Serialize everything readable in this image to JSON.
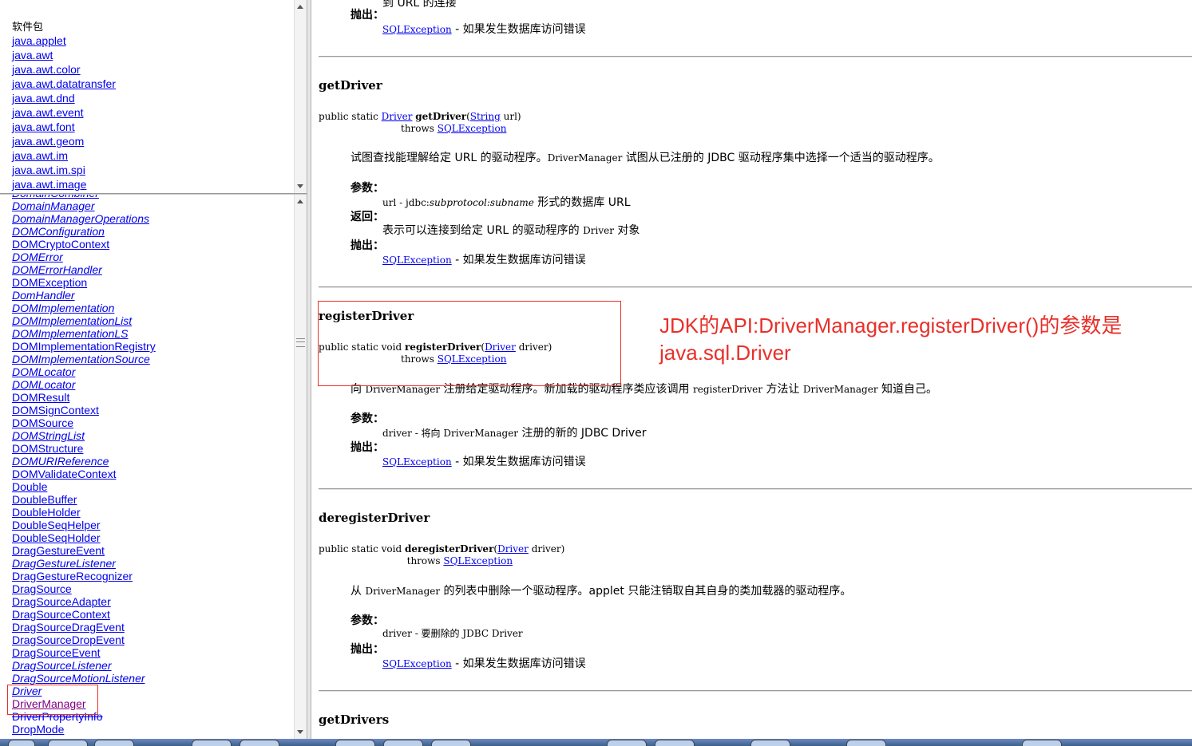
{
  "package_frame": {
    "heading": "软件包",
    "items": [
      "java.applet",
      "java.awt",
      "java.awt.color",
      "java.awt.datatransfer",
      "java.awt.dnd",
      "java.awt.event",
      "java.awt.font",
      "java.awt.geom",
      "java.awt.im",
      "java.awt.im.spi",
      "java.awt.image"
    ]
  },
  "class_frame": {
    "items": [
      {
        "label": "DomainCombiner",
        "italic": true
      },
      {
        "label": "DomainManager",
        "italic": true
      },
      {
        "label": "DomainManagerOperations",
        "italic": true
      },
      {
        "label": "DOMConfiguration",
        "italic": true
      },
      {
        "label": "DOMCryptoContext",
        "italic": false
      },
      {
        "label": "DOMError",
        "italic": true
      },
      {
        "label": "DOMErrorHandler",
        "italic": true
      },
      {
        "label": "DOMException",
        "italic": false
      },
      {
        "label": "DomHandler",
        "italic": true
      },
      {
        "label": "DOMImplementation",
        "italic": true
      },
      {
        "label": "DOMImplementationList",
        "italic": true
      },
      {
        "label": "DOMImplementationLS",
        "italic": true
      },
      {
        "label": "DOMImplementationRegistry",
        "italic": false
      },
      {
        "label": "DOMImplementationSource",
        "italic": true
      },
      {
        "label": "DOMLocator",
        "italic": true
      },
      {
        "label": "DOMLocator",
        "italic": true
      },
      {
        "label": "DOMResult",
        "italic": false
      },
      {
        "label": "DOMSignContext",
        "italic": false
      },
      {
        "label": "DOMSource",
        "italic": false
      },
      {
        "label": "DOMStringList",
        "italic": true
      },
      {
        "label": "DOMStructure",
        "italic": false
      },
      {
        "label": "DOMURIReference",
        "italic": true
      },
      {
        "label": "DOMValidateContext",
        "italic": false
      },
      {
        "label": "Double",
        "italic": false
      },
      {
        "label": "DoubleBuffer",
        "italic": false
      },
      {
        "label": "DoubleHolder",
        "italic": false
      },
      {
        "label": "DoubleSeqHelper",
        "italic": false
      },
      {
        "label": "DoubleSeqHolder",
        "italic": false
      },
      {
        "label": "DragGestureEvent",
        "italic": false
      },
      {
        "label": "DragGestureListener",
        "italic": true
      },
      {
        "label": "DragGestureRecognizer",
        "italic": false
      },
      {
        "label": "DragSource",
        "italic": false
      },
      {
        "label": "DragSourceAdapter",
        "italic": false
      },
      {
        "label": "DragSourceContext",
        "italic": false
      },
      {
        "label": "DragSourceDragEvent",
        "italic": false
      },
      {
        "label": "DragSourceDropEvent",
        "italic": false
      },
      {
        "label": "DragSourceEvent",
        "italic": false
      },
      {
        "label": "DragSourceListener",
        "italic": true
      },
      {
        "label": "DragSourceMotionListener",
        "italic": true
      },
      {
        "label": "Driver",
        "italic": true
      },
      {
        "label": "DriverManager",
        "italic": false,
        "visited": true
      },
      {
        "label": "DriverPropertyInfo",
        "italic": false,
        "strike": true
      },
      {
        "label": "DropMode",
        "italic": false
      }
    ]
  },
  "main": {
    "top_fragment": {
      "partial": "到 URL 的连接",
      "throws_label": "抛出：",
      "throws_link": "SQLException",
      "throws_desc": " - 如果发生数据库访问错误"
    },
    "getDriver": {
      "name": "getDriver",
      "sig_prefix": "public static ",
      "sig_type": "Driver",
      "sig_space": " ",
      "sig_method": "getDriver",
      "sig_open": "(",
      "sig_param_type": "String",
      "sig_param": " url)",
      "sig_throws_indent": "                           throws ",
      "sig_throws": "SQLException",
      "desc_a": "试图查找能理解给定 URL 的驱动程序。",
      "desc_code": "DriverManager",
      "desc_b": " 试图从已注册的 JDBC 驱动程序集中选择一个适当的驱动程序。",
      "params_label": "参数：",
      "param_a": "url - jdbc:",
      "param_italic": "subprotocol:subname",
      "param_b": " 形式的数据库 URL",
      "returns_label": "返回：",
      "returns_a": "表示可以连接到给定 URL 的驱动程序的 ",
      "returns_code": "Driver",
      "returns_b": " 对象",
      "throws_label": "抛出：",
      "throws_link": "SQLException",
      "throws_desc": " - 如果发生数据库访问错误"
    },
    "registerDriver": {
      "name": "registerDriver",
      "sig_prefix": "public static void ",
      "sig_method": "registerDriver",
      "sig_open": "(",
      "sig_param_type": "Driver",
      "sig_param": " driver)",
      "sig_throws_indent": "                           throws ",
      "sig_throws": "SQLException",
      "desc_a": "向 ",
      "desc_code1": "DriverManager",
      "desc_b": " 注册给定驱动程序。新加载的驱动程序类应该调用 ",
      "desc_code2": "registerDriver",
      "desc_c": " 方法让 ",
      "desc_code3": "DriverManager",
      "desc_d": " 知道自己。",
      "params_label": "参数：",
      "param_a": "driver - 将向 ",
      "param_code": "DriverManager",
      "param_b": " 注册的新的 JDBC Driver",
      "throws_label": "抛出：",
      "throws_link": "SQLException",
      "throws_desc": " - 如果发生数据库访问错误"
    },
    "deregisterDriver": {
      "name": "deregisterDriver",
      "sig_prefix": "public static void ",
      "sig_method": "deregisterDriver",
      "sig_open": "(",
      "sig_param_type": "Driver",
      "sig_param": " driver)",
      "sig_throws_indent": "                             throws ",
      "sig_throws": "SQLException",
      "desc_a": "从 ",
      "desc_code": "DriverManager",
      "desc_b": " 的列表中删除一个驱动程序。applet 只能注销取自其自身的类加载器的驱动程序。",
      "params_label": "参数：",
      "param_a": "driver - 要删除的 JDBC Driver",
      "throws_label": "抛出：",
      "throws_link": "SQLException",
      "throws_desc": " - 如果发生数据库访问错误"
    },
    "getDrivers": {
      "name": "getDrivers"
    }
  },
  "annotation": {
    "line1": "JDK的API:DriverManager.registerDriver()的参数是",
    "line2": "java.sql.Driver",
    "color": "#e8302a"
  },
  "colors": {
    "link": "#0000ee",
    "visited": "#800080",
    "annotation": "#e8302a"
  }
}
